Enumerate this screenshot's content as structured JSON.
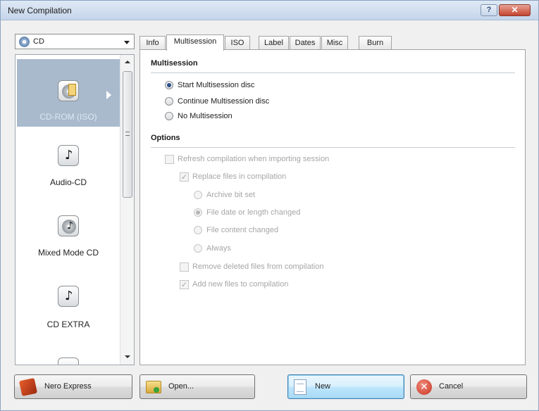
{
  "window": {
    "title": "New Compilation",
    "help_glyph": "?",
    "close_glyph": "✕"
  },
  "media_combo": {
    "value": "CD",
    "icon": "cd-disc-icon"
  },
  "categories": [
    {
      "label": "CD-ROM (ISO)",
      "icon": "cd-rom-icon",
      "selected": true
    },
    {
      "label": "Audio-CD",
      "icon": "audio-cd-icon",
      "selected": false
    },
    {
      "label": "Mixed Mode CD",
      "icon": "mixed-mode-cd-icon",
      "selected": false
    },
    {
      "label": "CD EXTRA",
      "icon": "cd-extra-icon",
      "selected": false
    }
  ],
  "tabs": [
    {
      "label": "Info",
      "active": false
    },
    {
      "label": "Multisession",
      "active": true
    },
    {
      "label": "ISO",
      "active": false
    },
    {
      "label": "Label",
      "active": false
    },
    {
      "label": "Dates",
      "active": false
    },
    {
      "label": "Misc",
      "active": false
    },
    {
      "label": "Burn",
      "active": false
    }
  ],
  "multisession": {
    "title": "Multisession",
    "options": [
      {
        "label": "Start Multisession disc",
        "selected": true
      },
      {
        "label": "Continue Multisession disc",
        "selected": false
      },
      {
        "label": "No Multisession",
        "selected": false
      }
    ]
  },
  "options": {
    "title": "Options",
    "refresh_compilation": {
      "label": "Refresh compilation when importing session",
      "checked": false,
      "enabled": false
    },
    "replace_files": {
      "label": "Replace files in compilation",
      "checked": true,
      "enabled": false
    },
    "replace_modes": [
      {
        "label": "Archive bit set",
        "selected": false
      },
      {
        "label": "File date or length changed",
        "selected": true
      },
      {
        "label": "File content changed",
        "selected": false
      },
      {
        "label": "Always",
        "selected": false
      }
    ],
    "remove_deleted": {
      "label": "Remove deleted files from compilation",
      "checked": false,
      "enabled": false
    },
    "add_new": {
      "label": "Add new files to compilation",
      "checked": true,
      "enabled": false
    }
  },
  "buttons": {
    "nero_express": "Nero Express",
    "open": "Open...",
    "new": "New",
    "cancel": "Cancel"
  }
}
